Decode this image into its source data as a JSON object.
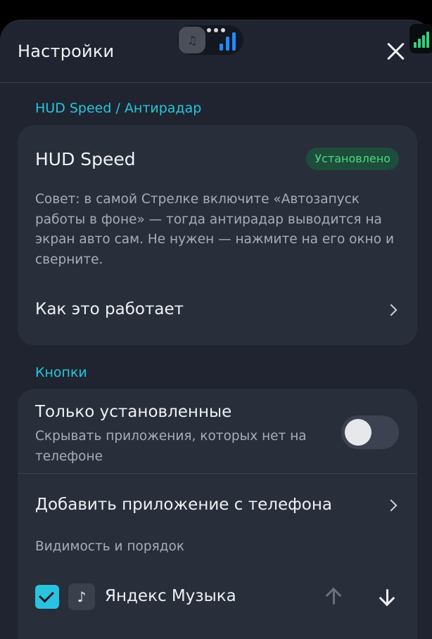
{
  "header": {
    "title": "Настройки",
    "close_icon": "close-icon"
  },
  "hud_section": {
    "label": "HUD Speed / Антирадар",
    "card": {
      "title": "HUD Speed",
      "badge": "Установлено",
      "hint": "Совет: в самой Стрелке включите «Автозапуск работы в фоне» — тогда антирадар выводится на экран авто сам. Не нужен — нажмите на его окно и сверните.",
      "link_label": "Как это работает"
    }
  },
  "buttons_section": {
    "label": "Кнопки",
    "only_installed": {
      "title": "Только установленные",
      "subtitle": "Скрывать приложения, которых нет на телефоне",
      "enabled": false
    },
    "add_app_label": "Добавить приложение с телефона",
    "visibility_heading": "Видимость и порядок",
    "apps": [
      {
        "name": "Яндекс Музыка",
        "checked": true,
        "icon": "music-note-icon"
      }
    ]
  },
  "colors": {
    "accent": "#26c6da",
    "badge_text": "#4fd68a",
    "card_bg": "#282e3a",
    "sheet_bg": "#1f2430"
  }
}
